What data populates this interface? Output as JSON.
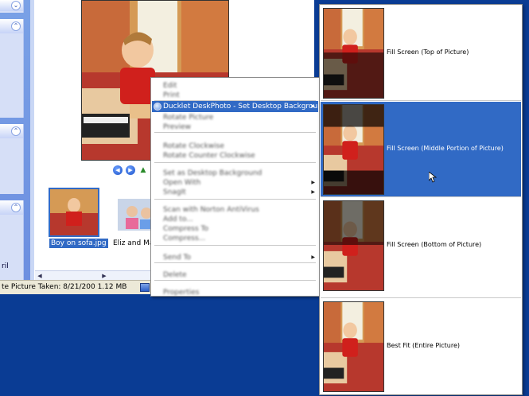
{
  "explorer": {
    "side_text": "ril",
    "thumbnails": [
      {
        "label": "Boy on sofa.jpg",
        "selected": true
      },
      {
        "label": "Eliz and Maria",
        "selected": false
      }
    ],
    "status_text": "te Picture Taken: 8/21/200 1.12 MB"
  },
  "icons": {
    "chevron_up": "⌃",
    "chevron_down": "⌄",
    "prev": "◀",
    "next": "▶",
    "submenu_arrow": "▶",
    "scroll_left": "◀",
    "scroll_right": "▶"
  },
  "context_menu": {
    "items": [
      {
        "label": "Edit",
        "blurred": true,
        "arrow": false
      },
      {
        "label": "Print",
        "blurred": true,
        "arrow": false
      },
      {
        "label": "Ducklet DeskPhoto - Set Desktop Background",
        "blurred": false,
        "arrow": true,
        "active": true
      },
      {
        "label": "Rotate Picture",
        "blurred": true,
        "arrow": false
      },
      {
        "label": "Preview",
        "blurred": true,
        "arrow": false
      },
      {
        "label": "Rotate Clockwise",
        "blurred": true,
        "arrow": false
      },
      {
        "label": "Rotate Counter Clockwise",
        "blurred": true,
        "arrow": false
      },
      {
        "label": "Set as Desktop Background",
        "blurred": true,
        "arrow": false
      },
      {
        "label": "Open With",
        "blurred": true,
        "arrow": true
      },
      {
        "label": "SnagIt",
        "blurred": true,
        "arrow": true
      },
      {
        "label": "Scan with Norton AntiVirus",
        "blurred": true,
        "arrow": false
      },
      {
        "label": "Add to...",
        "blurred": true,
        "arrow": false
      },
      {
        "label": "Compress To",
        "blurred": true,
        "arrow": false
      },
      {
        "label": "Compress...",
        "blurred": true,
        "arrow": false
      },
      {
        "label": "Send To",
        "blurred": true,
        "arrow": true
      },
      {
        "label": "Delete",
        "blurred": true,
        "arrow": false
      },
      {
        "label": "Properties",
        "blurred": true,
        "arrow": false
      }
    ]
  },
  "submenu": {
    "items": [
      {
        "label": "Fill Screen (Top of Picture)",
        "active": false
      },
      {
        "label": "Fill Screen (Middle Portion of Picture)",
        "active": true
      },
      {
        "label": "Fill Screen (Bottom of Picture)",
        "active": false
      },
      {
        "label": "Best Fit (Entire Picture)",
        "active": false
      }
    ]
  },
  "colors": {
    "desktop": "#0a3c94",
    "highlight": "#316ac5",
    "sofa_red": "#c0322a",
    "curtain": "#d8893a"
  }
}
